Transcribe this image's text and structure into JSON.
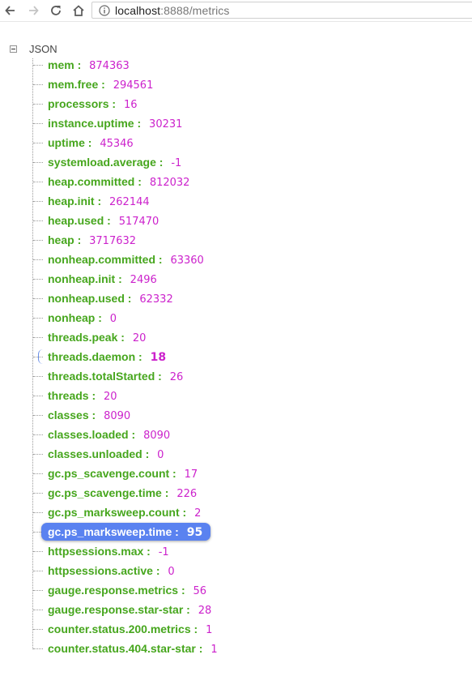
{
  "browser": {
    "url_host": "localhost",
    "url_rest": ":8888/metrics"
  },
  "tree": {
    "root_label": "JSON",
    "entries": [
      {
        "key": "mem",
        "value": "874363"
      },
      {
        "key": "mem.free",
        "value": "294561"
      },
      {
        "key": "processors",
        "value": "16"
      },
      {
        "key": "instance.uptime",
        "value": "30231"
      },
      {
        "key": "uptime",
        "value": "45346"
      },
      {
        "key": "systemload.average",
        "value": "-1"
      },
      {
        "key": "heap.committed",
        "value": "812032"
      },
      {
        "key": "heap.init",
        "value": "262144"
      },
      {
        "key": "heap.used",
        "value": "517470"
      },
      {
        "key": "heap",
        "value": "3717632"
      },
      {
        "key": "nonheap.committed",
        "value": "63360"
      },
      {
        "key": "nonheap.init",
        "value": "2496"
      },
      {
        "key": "nonheap.used",
        "value": "62332"
      },
      {
        "key": "nonheap",
        "value": "0"
      },
      {
        "key": "threads.peak",
        "value": "20"
      },
      {
        "key": "threads.daemon",
        "value": "18",
        "state": "hover"
      },
      {
        "key": "threads.totalStarted",
        "value": "26"
      },
      {
        "key": "threads",
        "value": "20"
      },
      {
        "key": "classes",
        "value": "8090"
      },
      {
        "key": "classes.loaded",
        "value": "8090"
      },
      {
        "key": "classes.unloaded",
        "value": "0"
      },
      {
        "key": "gc.ps_scavenge.count",
        "value": "17"
      },
      {
        "key": "gc.ps_scavenge.time",
        "value": "226"
      },
      {
        "key": "gc.ps_marksweep.count",
        "value": "2"
      },
      {
        "key": "gc.ps_marksweep.time",
        "value": "95",
        "state": "selected"
      },
      {
        "key": "httpsessions.max",
        "value": "-1"
      },
      {
        "key": "httpsessions.active",
        "value": "0"
      },
      {
        "key": "gauge.response.metrics",
        "value": "56"
      },
      {
        "key": "gauge.response.star-star",
        "value": "28"
      },
      {
        "key": "counter.status.200.metrics",
        "value": "1"
      },
      {
        "key": "counter.status.404.star-star",
        "value": "1"
      }
    ],
    "separator": " : "
  },
  "colors": {
    "key": "#46a61d",
    "value": "#cc22cc",
    "selection": "#5a82f0"
  }
}
